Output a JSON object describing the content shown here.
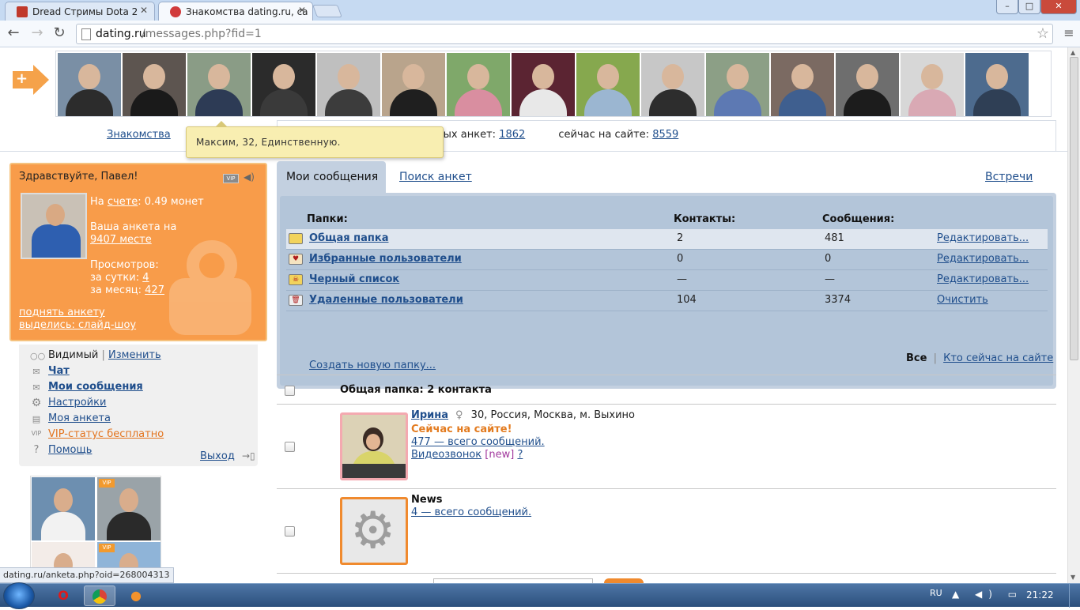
{
  "browser": {
    "tabs": [
      {
        "title": "Dread Стримы Dota 2",
        "favicon_color": "#c0392b"
      },
      {
        "title": "Знакомства dating.ru, са",
        "favicon_color": "#d13b3b"
      }
    ],
    "url_host": "dating.ru",
    "url_path": "/messages.php?fid=1",
    "window_controls": {
      "minimize": "–",
      "maximize": "□",
      "close": "✕"
    }
  },
  "header": {
    "nav_link": "Знакомства",
    "new_profiles_label": "вых анкет:",
    "new_profiles_value": "1862",
    "online_label": "сейчас на сайте:",
    "online_value": "8559",
    "tooltip": "Максим, 32, Единственную.",
    "photo_strip_colors": [
      {
        "bg": "#7a8fa5",
        "body": "#2c2c2c"
      },
      {
        "bg": "#5d5550",
        "body": "#1a1a1a"
      },
      {
        "bg": "#8a9c86",
        "body": "#2d3b55"
      },
      {
        "bg": "#2b2b2b",
        "body": "#3a3a3a"
      },
      {
        "bg": "#bfbfbf",
        "body": "#3c3c3c"
      },
      {
        "bg": "#b9a48c",
        "body": "#1f1f1f"
      },
      {
        "bg": "#7fa86a",
        "body": "#d98ea0"
      },
      {
        "bg": "#5b2432",
        "body": "#e8e8e8"
      },
      {
        "bg": "#86a84e",
        "body": "#9bb6d1"
      },
      {
        "bg": "#c7c7c7",
        "body": "#2d2d2d"
      },
      {
        "bg": "#8c9f86",
        "body": "#5d79b3"
      },
      {
        "bg": "#7b6a62",
        "body": "#3f5f8f"
      },
      {
        "bg": "#6e6e6e",
        "body": "#1c1c1c"
      },
      {
        "bg": "#d7d7d7",
        "body": "#d9a9b4"
      },
      {
        "bg": "#4d6b8e",
        "body": "#2f3f55"
      }
    ]
  },
  "user_panel": {
    "greeting": "Здравствуйте, Павел!",
    "vip": "VIP",
    "balance_prefix": "На",
    "balance_link": "счете",
    "balance_suffix": ": 0.49 монет",
    "rank_text": "Ваша анкета на",
    "rank_link": "9407 месте",
    "views_label": "Просмотров:",
    "views_day_label": "за сутки:",
    "views_day": "4",
    "views_month_label": "за месяц:",
    "views_month": "427",
    "raise_link": "поднять анкету",
    "slideshow_link": "выделись: слайд-шоу"
  },
  "left_menu": {
    "visible_label": "Видимый",
    "visible_sep": "|",
    "change_link": "Изменить",
    "items": [
      {
        "label": "Чат"
      },
      {
        "label": "Мои сообщения"
      },
      {
        "label": "Настройки"
      },
      {
        "label": "Моя анкета"
      },
      {
        "label": "VIP-статус бесплатно",
        "color": "#e3741e"
      },
      {
        "label": "Помощь"
      }
    ],
    "logout": "Выход"
  },
  "photo_grid": [
    {
      "bg": "#6d8fb0",
      "body": "#f2f2f2",
      "vip": false
    },
    {
      "bg": "#9aa3a8",
      "body": "#2a2a2a",
      "vip": true,
      "vip_label": "VIP"
    },
    {
      "bg": "#f3ece8",
      "body": "#d83a2a",
      "vip": false
    },
    {
      "bg": "#8fb4d8",
      "body": "#e6e6e6",
      "vip": true,
      "vip_label": "VIP"
    }
  ],
  "main": {
    "tabs": [
      {
        "label": "Мои сообщения"
      },
      {
        "label": "Поиск анкет"
      },
      {
        "label": "Встречи"
      }
    ],
    "folders": {
      "headers": {
        "name": "Папки:",
        "contacts": "Контакты:",
        "messages": "Сообщения:"
      },
      "rows": [
        {
          "name": "Общая папка",
          "contacts": "2",
          "messages": "481",
          "action": "Редактировать...",
          "icon": "folder-icon"
        },
        {
          "name": "Избранные пользователи",
          "contacts": "0",
          "messages": "0",
          "action": "Редактировать...",
          "icon": "heart-icon"
        },
        {
          "name": "Черный список",
          "contacts": "—",
          "messages": "—",
          "action": "Редактировать...",
          "icon": "skull-icon"
        },
        {
          "name": "Удаленные пользователи",
          "contacts": "104",
          "messages": "3374",
          "action": "Очистить",
          "icon": "trash-icon"
        }
      ],
      "new_folder": "Создать новую папку..."
    },
    "filter": {
      "all": "Все",
      "sep": "|",
      "online": "Кто сейчас на сайте"
    },
    "list_title": "Общая папка: 2 контакта",
    "contacts": [
      {
        "name": "Ирина",
        "gender_icon": "♀",
        "info": "30, Россия, Москва, м. Выхино",
        "online": "Сейчас на сайте!",
        "messages": "477 — всего сообщений.",
        "video_label": "Видеозвонок",
        "video_new": "[new]",
        "video_help": "?"
      },
      {
        "name": "News",
        "messages": "4 — всего сообщений."
      }
    ]
  },
  "status_url": "dating.ru/anketa.php?oid=268004313",
  "taskbar": {
    "lang": "RU",
    "tray": "▲ ◀) ▭",
    "clock": "21:22"
  }
}
